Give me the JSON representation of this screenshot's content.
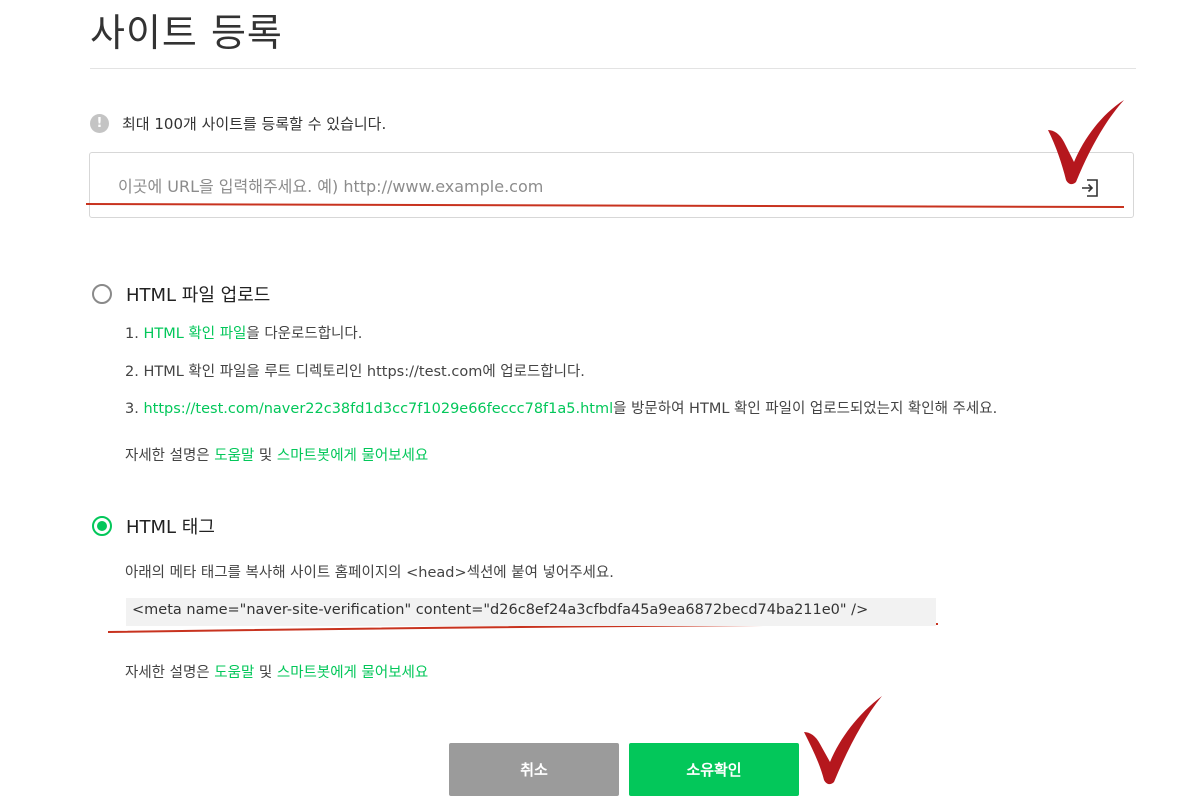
{
  "page": {
    "title": "사이트 등록"
  },
  "notice": {
    "icon": "info-icon",
    "text": "최대 100개 사이트를 등록할 수 있습니다."
  },
  "url_input": {
    "placeholder": "이곳에 URL을 입력해주세요. 예) http://www.example.com",
    "value": "",
    "submit_icon": "enter-icon"
  },
  "html_file": {
    "label": "HTML 파일 업로드",
    "selected": false,
    "step1": {
      "prefix": "1. ",
      "link": "HTML 확인 파일",
      "suffix": "을 다운로드합니다."
    },
    "step2": "2. HTML 확인 파일을 루트 디렉토리인 https://test.com에 업로드합니다.",
    "step3": {
      "prefix": "3. ",
      "link": "https://test.com/naver22c38fd1d3cc7f1029e66feccc78f1a5.html",
      "suffix": "을 방문하여 HTML 확인 파일이 업로드되었는지 확인해 주세요."
    },
    "help": {
      "prefix": "자세한 설명은 ",
      "link1": "도움말",
      "middle": " 및 ",
      "link2": "스마트봇에게 물어보세요"
    }
  },
  "html_tag": {
    "label": "HTML 태그",
    "selected": true,
    "description": "아래의 메타 태그를 복사해 사이트 홈페이지의 <head>섹션에 붙여 넣어주세요.",
    "meta": "<meta name=\"naver-site-verification\" content=\"d26c8ef24a3cfbdfa45a9ea6872becd74ba211e0\" />",
    "help": {
      "prefix": "자세한 설명은 ",
      "link1": "도움말",
      "middle": " 및 ",
      "link2": "스마트봇에게 물어보세요"
    }
  },
  "buttons": {
    "cancel": "취소",
    "confirm": "소유확인"
  },
  "colors": {
    "accent": "#03c75a",
    "cancel": "#9b9b9b",
    "annotation": "#b5171d"
  }
}
